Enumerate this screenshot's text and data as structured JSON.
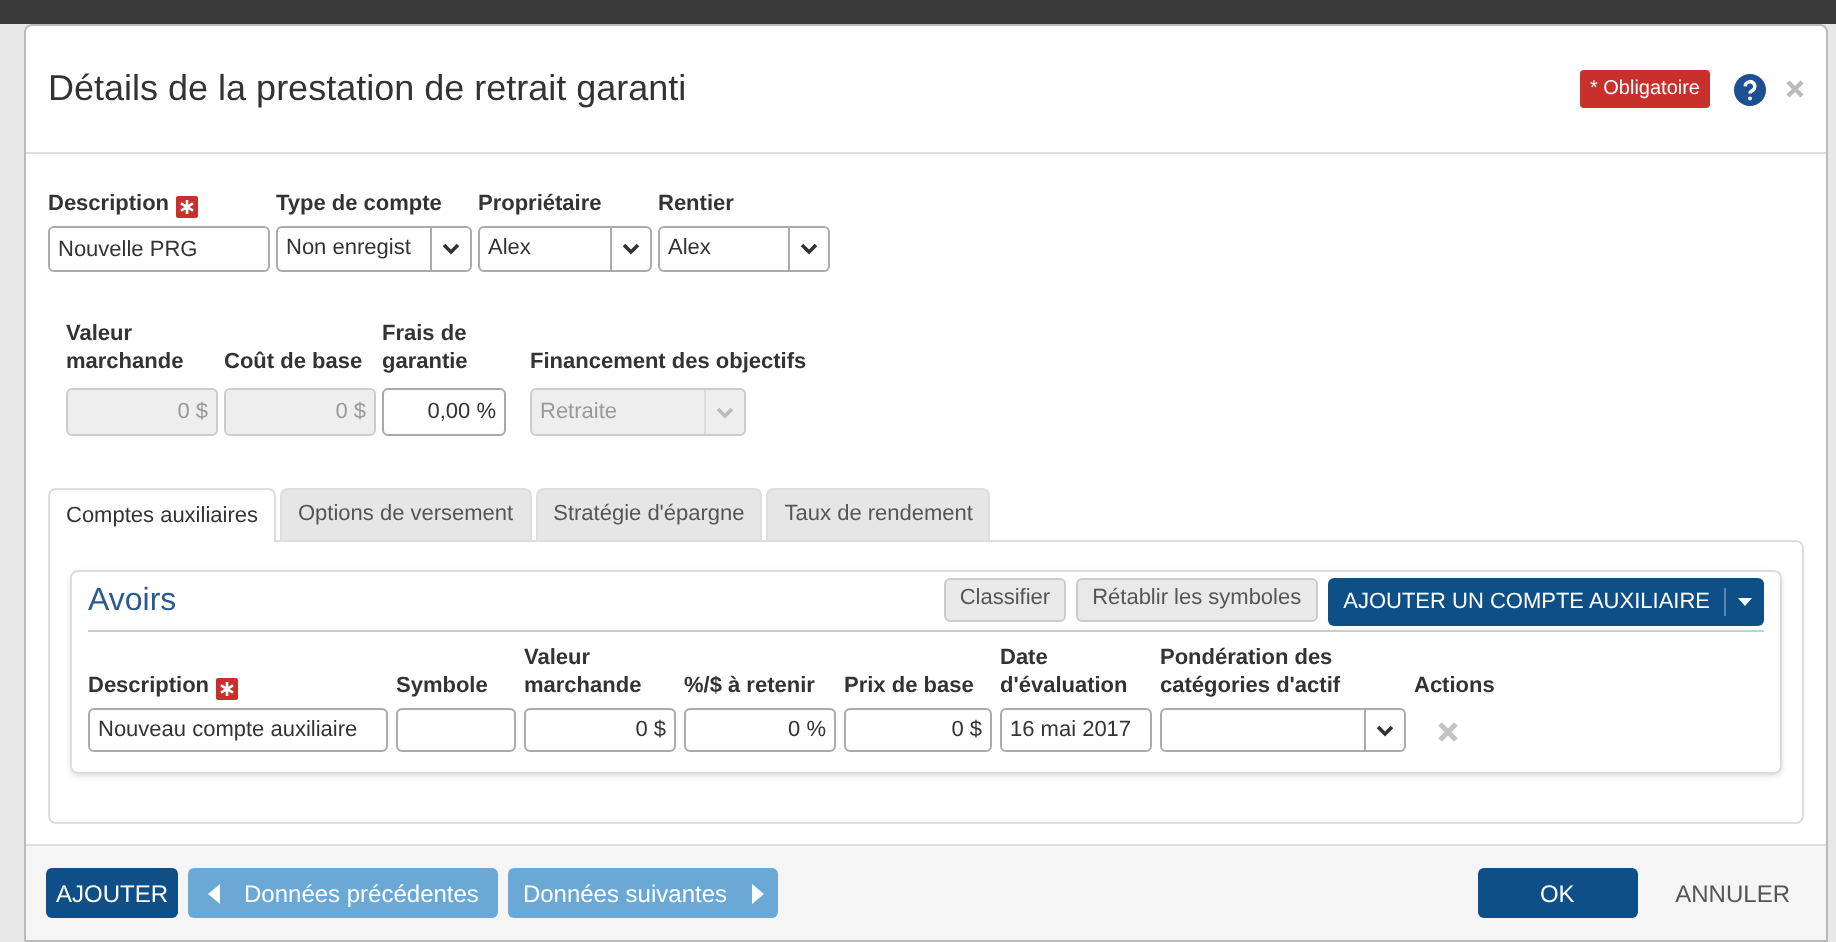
{
  "dialog": {
    "title": "Détails de la prestation de retrait garanti",
    "required_badge": "* Obligatoire"
  },
  "fields_row1": [
    {
      "kind": "text",
      "label": "Description",
      "required": true,
      "value": "Nouvelle PRG",
      "disabled": false
    },
    {
      "kind": "select",
      "label": "Type de compte",
      "required": false,
      "value": "Non enregist",
      "disabled": false
    },
    {
      "kind": "select",
      "label": "Propriétaire",
      "required": false,
      "value": "Alex",
      "disabled": false
    },
    {
      "kind": "select",
      "label": "Rentier",
      "required": false,
      "value": "Alex",
      "disabled": false
    }
  ],
  "fields_row2": [
    {
      "kind": "number",
      "label": "Valeur marchande",
      "required": false,
      "value": "0 $",
      "disabled": true
    },
    {
      "kind": "number",
      "label": "Coût de base",
      "required": false,
      "value": "0 $",
      "disabled": true
    },
    {
      "kind": "number",
      "label": "Frais de garantie",
      "required": false,
      "value": "0,00 %",
      "disabled": false
    },
    {
      "kind": "select",
      "label": "Financement des objectifs",
      "required": false,
      "value": "Retraite",
      "disabled": true
    }
  ],
  "tabs": [
    {
      "label": "Comptes auxiliaires",
      "selected": true
    },
    {
      "label": "Options de versement",
      "selected": false
    },
    {
      "label": "Stratégie d'épargne",
      "selected": false
    },
    {
      "label": "Taux de rendement",
      "selected": false
    }
  ],
  "holdings": {
    "title": "Avoirs",
    "buttons": [
      "Classifier",
      "Rétablir les symboles"
    ],
    "add_button": "AJOUTER UN COMPTE AUXILIAIRE",
    "columns": [
      {
        "label": "Description",
        "required": true
      },
      {
        "label": "Symbole",
        "required": false
      },
      {
        "label": "Valeur marchande",
        "required": false
      },
      {
        "label": "%/$ à retenir",
        "required": false
      },
      {
        "label": "Prix de base",
        "required": false
      },
      {
        "label": "Date d'évaluation",
        "required": false
      },
      {
        "label": "Pondération des catégories d'actif",
        "required": false
      },
      {
        "label": "Actions",
        "required": false
      }
    ],
    "rows": [
      {
        "cells": [
          {
            "kind": "text",
            "value": "Nouveau compte auxiliaire"
          },
          {
            "kind": "text"
          },
          {
            "kind": "number",
            "value": "0 $"
          },
          {
            "kind": "number",
            "value": "0 %"
          },
          {
            "kind": "number",
            "value": "0 $"
          },
          {
            "kind": "text",
            "value": "16 mai 2017"
          },
          {
            "kind": "select"
          },
          {
            "kind": "action"
          }
        ]
      }
    ]
  },
  "footer": {
    "add": "AJOUTER",
    "previous": "Données précédentes",
    "next": "Données suivantes",
    "ok": "OK",
    "cancel": "ANNULER"
  }
}
